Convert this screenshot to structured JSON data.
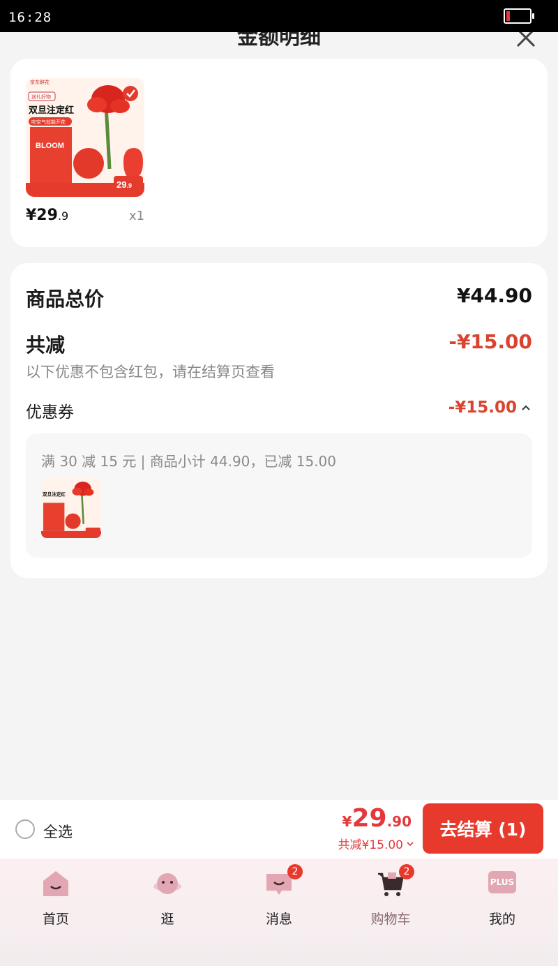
{
  "status_bar": {
    "time": "16:28"
  },
  "sheet": {
    "title": "金额明细"
  },
  "product": {
    "price_int": "¥29",
    "price_dec": ".9",
    "quantity": "x1",
    "thumb_text": {
      "brand": "京东鲜花",
      "tag": "送礼好物",
      "headline": "双旦注定红",
      "slogan": "吃空气就能开花",
      "product_word": "BLOOM",
      "price_int": "29",
      "price_dec": ".9"
    }
  },
  "detail": {
    "total_label": "商品总价",
    "total_value": "¥44.90",
    "reduce_label": "共减",
    "reduce_value": "-¥15.00",
    "reduce_note": "以下优惠不包含红包，请在结算页查看",
    "coupon_label": "优惠券",
    "coupon_value": "-¥15.00",
    "coupon_desc": "满 30 减 15 元 | 商品小计 44.90，已减 15.00"
  },
  "checkout": {
    "select_all": "全选",
    "currency": "¥",
    "total_int": "29",
    "total_dec": ".90",
    "total_discount": "共减¥15.00",
    "button": "去结算 (1)"
  },
  "tabs": [
    {
      "label": "首页",
      "icon": "home-icon"
    },
    {
      "label": "逛",
      "icon": "planet-icon"
    },
    {
      "label": "消息",
      "icon": "message-icon",
      "badge": "2"
    },
    {
      "label": "购物车",
      "icon": "cart-icon",
      "badge": "2",
      "active": true
    },
    {
      "label": "我的",
      "icon": "plus-member-icon",
      "plus_text": "PLUS"
    }
  ],
  "colors": {
    "accent": "#e83a2c",
    "price_red": "#d9442f",
    "tab_pink": "#e2a7b2"
  }
}
